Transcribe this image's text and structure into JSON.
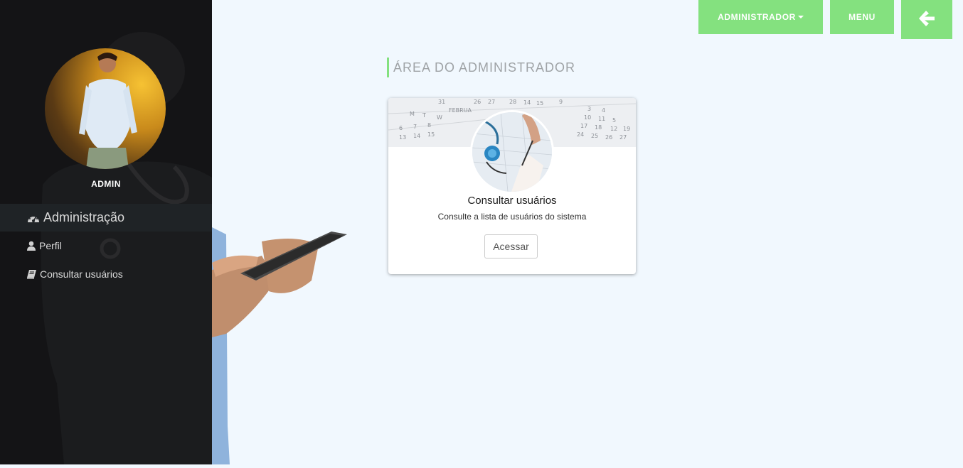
{
  "topbar": {
    "admin_label": "ADMINISTRADOR",
    "menu_label": "MENU",
    "back_icon": "arrow-left-icon"
  },
  "sidebar": {
    "user_name": "ADMIN",
    "items": [
      {
        "label": "Administração",
        "icon": "dashboard-icon",
        "active": true
      },
      {
        "label": "Perfil",
        "icon": "user-icon",
        "active": false
      },
      {
        "label": "Consultar usuários",
        "icon": "book-icon",
        "active": false
      }
    ]
  },
  "main": {
    "title": "ÁREA DO ADMINISTRADOR",
    "card": {
      "title": "Consultar usuários",
      "description": "Consulte a lista de usuários do sistema",
      "button_label": "Acessar"
    }
  },
  "colors": {
    "accent": "#84e17f",
    "sidebar_bg": "#141416",
    "page_bg": "#f1f8fe"
  }
}
